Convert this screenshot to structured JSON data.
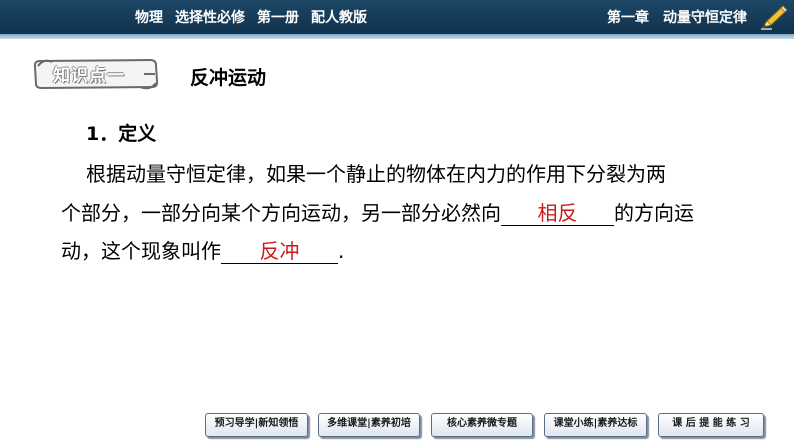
{
  "header": {
    "subject": "物理",
    "course": "选择性必修",
    "volume": "第一册",
    "edition": "配人教版",
    "chapter": "第一章",
    "chapter_title": "动量守恒定律"
  },
  "badge": {
    "label": "知识点一"
  },
  "topic": {
    "title": "反冲运动"
  },
  "section": {
    "title": "1．定义"
  },
  "paragraph": {
    "line1": "根据动量守恒定律，如果一个静止的物体在内力的作用下分裂为两",
    "line2_before": "个部分，一部分向某个方向运动，另一部分必然向",
    "blank1": "相反",
    "line2_after": "的方向运",
    "line3_before": "动，这个现象叫作",
    "blank2": "反冲",
    "line3_after": "."
  },
  "nav": {
    "items": [
      "预习导学|新知领悟",
      "多维课堂|素养初培",
      "核心素养微专题",
      "课堂小练|素养达标",
      "课 后 提 能 练 习"
    ]
  },
  "colors": {
    "header_bg": "#10324d",
    "answer_red": "#cc1a1a"
  }
}
